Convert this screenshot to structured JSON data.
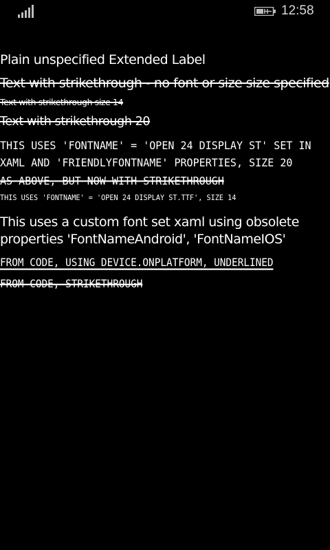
{
  "status_bar": {
    "signal_icon": "cell-signal-icon",
    "battery_icon": "battery-charging-icon",
    "time": "12:58",
    "icon_color": "#bdbdbd"
  },
  "labels": {
    "plain": "Plain unspecified Extended Label",
    "strike_default": "Text with strikethrough - no font or size size specified",
    "strike_14": "Text with strikethrough size 14",
    "strike_20": "Text with strikethrough 20",
    "fontname_xaml": "This uses 'FontName' = 'Open 24 Display St' set in XAML and 'FriendlyFontName' properties, size 20",
    "as_above_strike": "As above, but now with strikethrough",
    "fontname_ttf": "This uses 'FontName' = 'Open 24 Display St.ttf', size 14",
    "obsolete_props": "This uses a custom font set xaml using obsolete properties 'FontNameAndroid', 'FontNameIOS'",
    "code_underlined": "From code, using Device.OnPlatform, underlined",
    "code_strike": "From code, strikethrough"
  },
  "colors": {
    "background": "#000000",
    "text": "#ffffff"
  }
}
